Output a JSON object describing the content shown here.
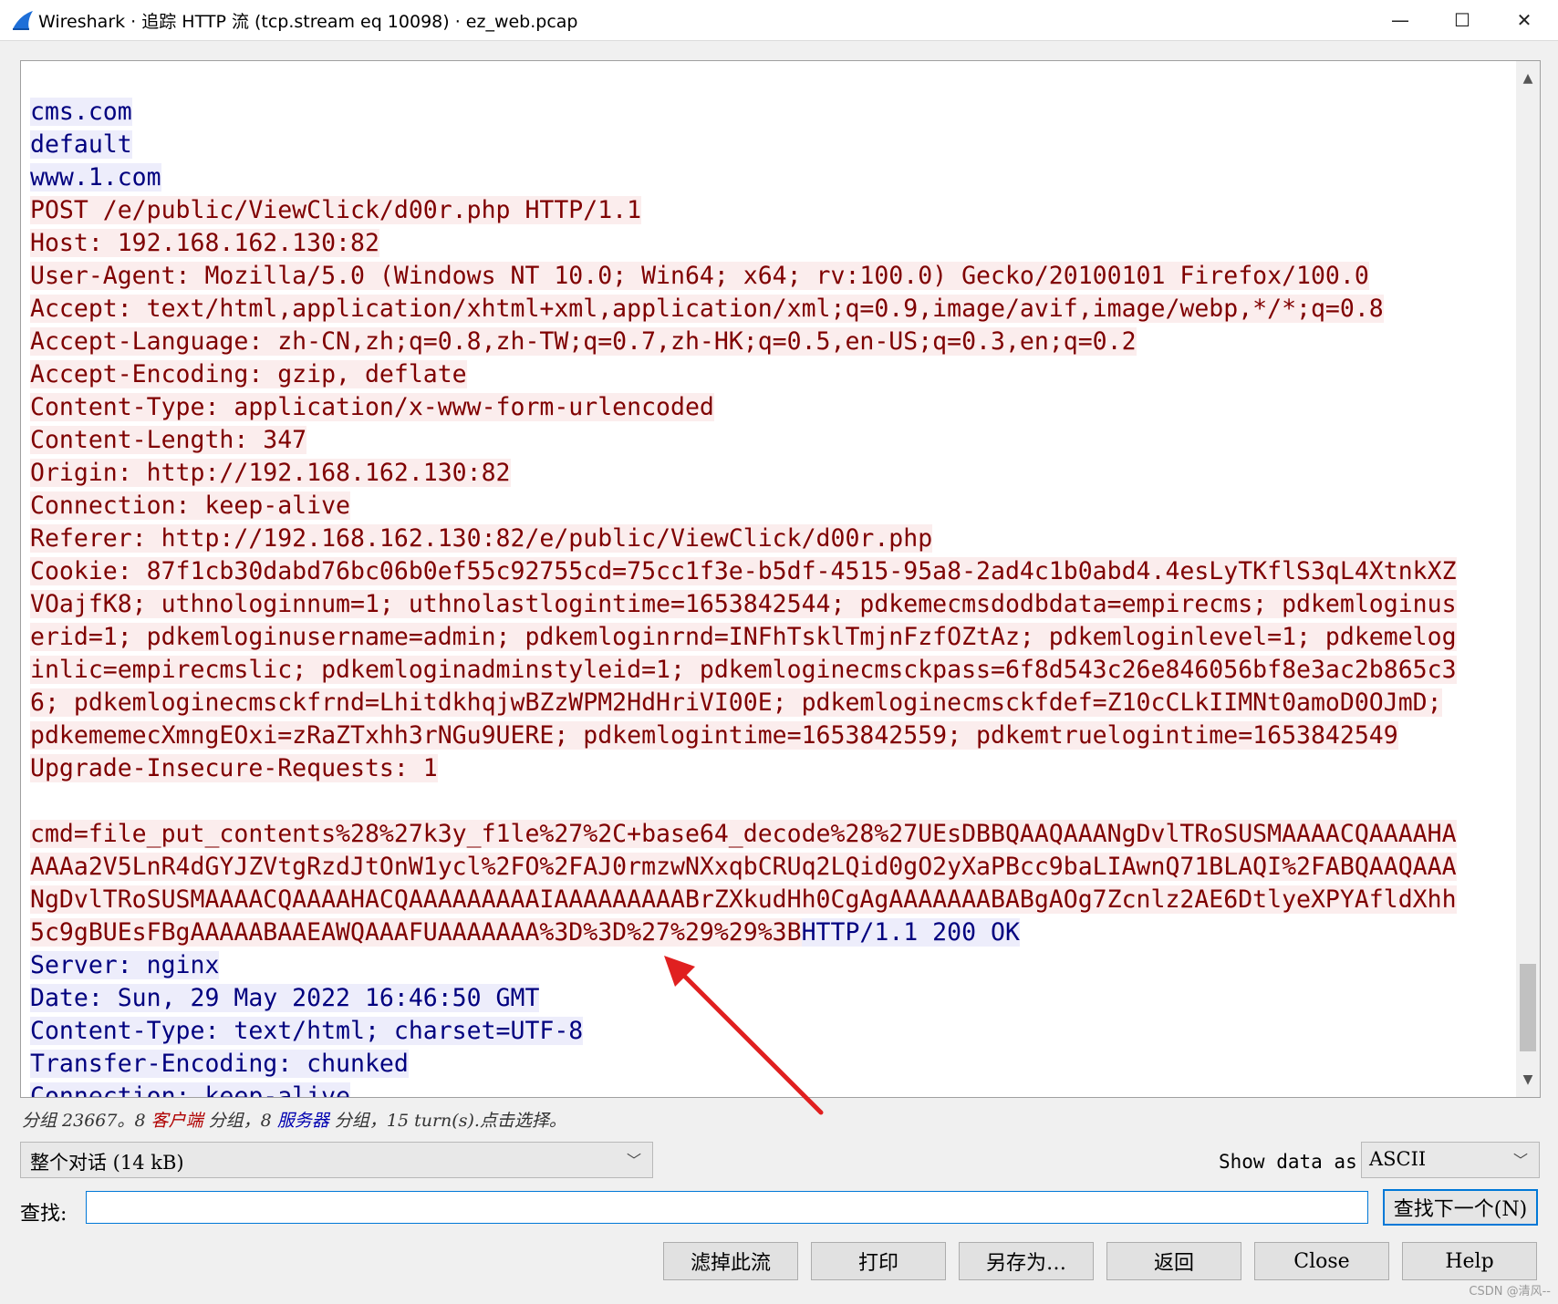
{
  "window": {
    "title": "Wireshark · 追踪 HTTP 流 (tcp.stream eq 10098) · ez_web.pcap",
    "minimize": "—",
    "maximize": "☐",
    "close": "✕"
  },
  "stream": {
    "colors": {
      "client_bg": "#fbeded",
      "client_fg": "#7f0000",
      "server_bg": "#ededfb",
      "server_fg": "#00007f"
    },
    "lines": [
      [
        {
          "t": "cms.com",
          "s": "server"
        }
      ],
      [
        {
          "t": "default",
          "s": "server"
        }
      ],
      [
        {
          "t": "www.1.com",
          "s": "server"
        }
      ],
      [
        {
          "t": "POST /e/public/ViewClick/d00r.php HTTP/1.1",
          "s": "client"
        }
      ],
      [
        {
          "t": "Host: 192.168.162.130:82",
          "s": "client"
        }
      ],
      [
        {
          "t": "User-Agent: Mozilla/5.0 (Windows NT 10.0; Win64; x64; rv:100.0) Gecko/20100101 Firefox/100.0",
          "s": "client"
        }
      ],
      [
        {
          "t": "Accept: text/html,application/xhtml+xml,application/xml;q=0.9,image/avif,image/webp,*/*;q=0.8",
          "s": "client"
        }
      ],
      [
        {
          "t": "Accept-Language: zh-CN,zh;q=0.8,zh-TW;q=0.7,zh-HK;q=0.5,en-US;q=0.3,en;q=0.2",
          "s": "client"
        }
      ],
      [
        {
          "t": "Accept-Encoding: gzip, deflate",
          "s": "client"
        }
      ],
      [
        {
          "t": "Content-Type: application/x-www-form-urlencoded",
          "s": "client"
        }
      ],
      [
        {
          "t": "Content-Length: 347",
          "s": "client"
        }
      ],
      [
        {
          "t": "Origin: http://192.168.162.130:82",
          "s": "client"
        }
      ],
      [
        {
          "t": "Connection: keep-alive",
          "s": "client"
        }
      ],
      [
        {
          "t": "Referer: http://192.168.162.130:82/e/public/ViewClick/d00r.php",
          "s": "client"
        }
      ],
      [
        {
          "t": "Cookie: 87f1cb30dabd76bc06b0ef55c92755cd=75cc1f3e-b5df-4515-95a8-2ad4c1b0abd4.4esLyTKflS3qL4XtnkXZ",
          "s": "client"
        }
      ],
      [
        {
          "t": "VOajfK8; uthnologinnum=1; uthnolastlogintime=1653842544; pdkemecmsdodbdata=empirecms; pdkemloginus",
          "s": "client"
        }
      ],
      [
        {
          "t": "erid=1; pdkemloginusername=admin; pdkemloginrnd=INFhTsklTmjnFzfOZtAz; pdkemloginlevel=1; pdkemelog",
          "s": "client"
        }
      ],
      [
        {
          "t": "inlic=empirecmslic; pdkemloginadminstyleid=1; pdkemloginecmsckpass=6f8d543c26e846056bf8e3ac2b865c3",
          "s": "client"
        }
      ],
      [
        {
          "t": "6; pdkemloginecmsckfrnd=LhitdkhqjwBZzWPM2HdHriVI00E; pdkemloginecmsckfdef=Z10cCLkIIMNt0amoD0OJmD;",
          "s": "client"
        }
      ],
      [
        {
          "t": "pdkememecXmngEOxi=zRaZTxhh3rNGu9UERE; pdkemlogintime=1653842559; pdkemtruelogintime=1653842549",
          "s": "client"
        }
      ],
      [
        {
          "t": "Upgrade-Insecure-Requests: 1",
          "s": "client"
        }
      ],
      [],
      [
        {
          "t": "cmd=file_put_contents%28%27k3y_f1le%27%2C+base64_decode%28%27UEsDBBQAAQAAANgDvlTRoSUSMAAAACQAAAAHA",
          "s": "client"
        }
      ],
      [
        {
          "t": "AAAa2V5LnR4dGYJZVtgRzdJtOnW1ycl%2FO%2FAJ0rmzwNXxqbCRUq2LQid0gO2yXaPBcc9baLIAwnQ71BLAQI%2FABQAAQAAA",
          "s": "client"
        }
      ],
      [
        {
          "t": "NgDvlTRoSUSMAAAACQAAAAHACQAAAAAAAAAIAAAAAAAAABrZXkudHh0CgAgAAAAAAABABgAOg7Zcnlz2AE6DtlyeXPYAfldXhh",
          "s": "client"
        }
      ],
      [
        {
          "t": "5c9gBUEsFBgAAAAABAAEAWQAAAFUAAAAAAA%3D%3D%27%29%29%3B",
          "s": "client"
        },
        {
          "t": "HTTP/1.1 200 OK",
          "s": "server"
        }
      ],
      [
        {
          "t": "Server: nginx",
          "s": "server"
        }
      ],
      [
        {
          "t": "Date: Sun, 29 May 2022 16:46:50 GMT",
          "s": "server"
        }
      ],
      [
        {
          "t": "Content-Type: text/html; charset=UTF-8",
          "s": "server"
        }
      ],
      [
        {
          "t": "Transfer-Encoding: chunked",
          "s": "server"
        }
      ],
      [
        {
          "t": "Connection: keep-alive",
          "s": "server"
        }
      ]
    ]
  },
  "status": {
    "prefix": "分组 23667。8 ",
    "client_word": "客户端",
    "middle": " 分组，8 ",
    "server_word": "服务器",
    "suffix": " 分组，15 turn(s).点击选择。"
  },
  "conversation_select": {
    "value": "整个对话 (14 kB)"
  },
  "show_data": {
    "label": "Show data as",
    "value": "ASCII"
  },
  "find": {
    "label": "查找:",
    "value": "",
    "next_button": "查找下一个(N)"
  },
  "buttons": {
    "filter_out": "滤掉此流",
    "print": "打印",
    "save_as": "另存为…",
    "back": "返回",
    "close": "Close",
    "help": "Help"
  },
  "watermark": "CSDN @清风--",
  "annotation_color": "#e02020"
}
